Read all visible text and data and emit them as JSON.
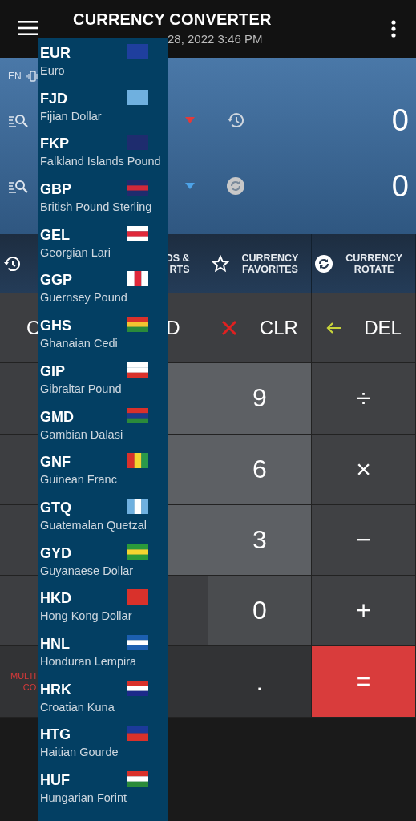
{
  "header": {
    "title": "CURRENCY CONVERTER",
    "subtitle": "28, 2022 3:46 PM"
  },
  "converter": {
    "language": "EN",
    "rows": [
      {
        "kind": "source",
        "amount": "0"
      },
      {
        "kind": "target",
        "amount": "0"
      }
    ]
  },
  "toolbar": [
    {
      "kind": "history"
    },
    {
      "kind": "text",
      "label": "DS &\nRTS"
    },
    {
      "kind": "favorites",
      "label": "CURRENCY\nFAVORITES"
    },
    {
      "kind": "rotate",
      "label": "CURRENCY\nROTATE"
    }
  ],
  "keypad": [
    [
      {
        "kind": "text-left",
        "label": "C"
      },
      {
        "kind": "text-right",
        "label": "D"
      },
      {
        "kind": "clear",
        "label": "CLR"
      },
      {
        "kind": "delete",
        "label": "DEL"
      }
    ],
    [
      {
        "kind": "blank"
      },
      {
        "kind": "digit-blank"
      },
      {
        "kind": "digit",
        "label": "9"
      },
      {
        "kind": "op",
        "label": "÷"
      }
    ],
    [
      {
        "kind": "blank"
      },
      {
        "kind": "digit-blank"
      },
      {
        "kind": "digit",
        "label": "6"
      },
      {
        "kind": "op",
        "label": "×"
      }
    ],
    [
      {
        "kind": "blank"
      },
      {
        "kind": "digit-blank"
      },
      {
        "kind": "digit",
        "label": "3"
      },
      {
        "kind": "op",
        "label": "−"
      }
    ],
    [
      {
        "kind": "blank"
      },
      {
        "kind": "blank"
      },
      {
        "kind": "zero",
        "label": "0"
      },
      {
        "kind": "op",
        "label": "+"
      }
    ],
    [
      {
        "kind": "multi",
        "label": "MULTI\nCO"
      },
      {
        "kind": "dark"
      },
      {
        "kind": "dark",
        "label": "."
      },
      {
        "kind": "equals",
        "label": "="
      }
    ]
  ],
  "dropdown": [
    {
      "code": "EUR",
      "name": "Euro"
    },
    {
      "code": "FJD",
      "name": "Fijian Dollar"
    },
    {
      "code": "FKP",
      "name": "Falkland Islands Pound"
    },
    {
      "code": "GBP",
      "name": "British Pound Sterling"
    },
    {
      "code": "GEL",
      "name": "Georgian Lari"
    },
    {
      "code": "GGP",
      "name": "Guernsey Pound"
    },
    {
      "code": "GHS",
      "name": "Ghanaian Cedi"
    },
    {
      "code": "GIP",
      "name": "Gibraltar Pound"
    },
    {
      "code": "GMD",
      "name": "Gambian Dalasi"
    },
    {
      "code": "GNF",
      "name": "Guinean Franc"
    },
    {
      "code": "GTQ",
      "name": "Guatemalan Quetzal"
    },
    {
      "code": "GYD",
      "name": "Guyanaese Dollar"
    },
    {
      "code": "HKD",
      "name": "Hong Kong Dollar"
    },
    {
      "code": "HNL",
      "name": "Honduran Lempira"
    },
    {
      "code": "HRK",
      "name": "Croatian Kuna"
    },
    {
      "code": "HTG",
      "name": "Haitian Gourde"
    },
    {
      "code": "HUF",
      "name": "Hungarian Forint"
    }
  ]
}
